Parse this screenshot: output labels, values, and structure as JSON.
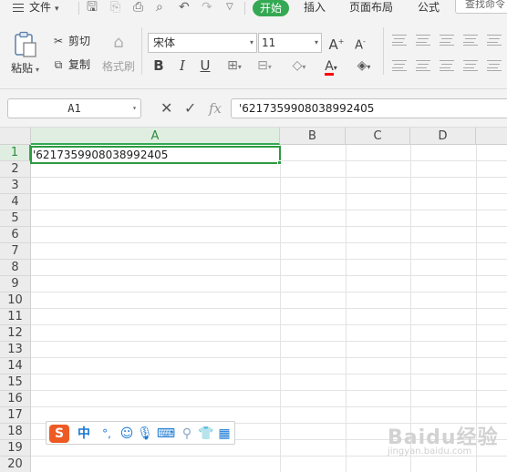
{
  "menubar": {
    "file_label": "文件",
    "tabs": [
      "开始",
      "插入",
      "页面布局",
      "公式"
    ],
    "active_tab": "开始",
    "search_placeholder": "查找命令"
  },
  "ribbon": {
    "paste_label": "粘贴",
    "cut_label": "剪切",
    "copy_label": "复制",
    "format_painter_label": "格式刷",
    "font_name": "宋体",
    "font_size": "11",
    "increase_font_glyph": "A",
    "decrease_font_glyph": "A",
    "bold_glyph": "B",
    "italic_glyph": "I",
    "underline_glyph": "U",
    "font_color_glyph": "A",
    "font_color": "#ff0000",
    "accent_color": "#34a853"
  },
  "formula_bar": {
    "name_box": "A1",
    "cancel_glyph": "✕",
    "confirm_glyph": "✓",
    "fx_glyph": "fx",
    "content": "'6217359908038992405"
  },
  "sheet": {
    "columns": [
      "A",
      "B",
      "C",
      "D"
    ],
    "rows": [
      "1",
      "2",
      "3",
      "4",
      "5",
      "6",
      "7",
      "8",
      "9",
      "10",
      "11",
      "12",
      "13",
      "14",
      "15",
      "16",
      "17",
      "18",
      "19",
      "20"
    ],
    "active_cell": "A1",
    "cell_a1_display": "'6217359908038992405"
  },
  "ime_toolbar": {
    "logo_glyph": "S",
    "mode_label": "中",
    "punct_label": "°,",
    "icons": [
      "emoji-icon",
      "mic-icon",
      "keyboard-icon",
      "user-icon",
      "skin-icon",
      "grid-icon"
    ]
  },
  "watermark": {
    "text": "Baidu经验",
    "sub": "jingyan.baidu.com"
  }
}
